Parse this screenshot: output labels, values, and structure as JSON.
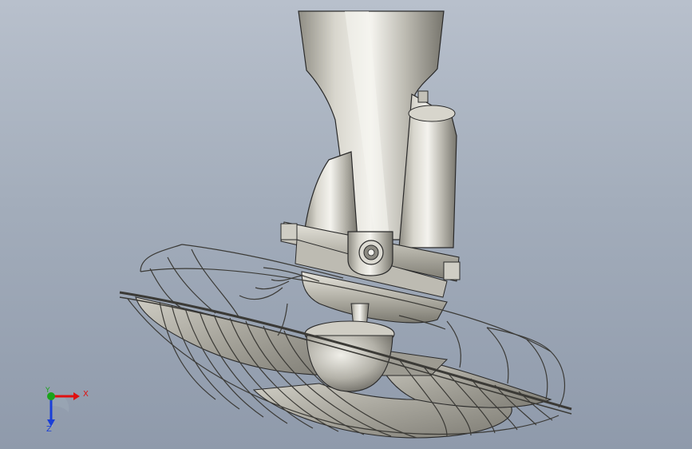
{
  "viewport": {
    "background_top": "#b8c0cc",
    "background_bottom": "#8f9aab"
  },
  "model": {
    "part_type": "ceiling-fan-assembly",
    "material_color": "#c8c6bd",
    "edge_color": "#2a2a2a"
  },
  "triad": {
    "x_label": "X",
    "y_label": "Y",
    "z_label": "Z",
    "x_color": "#e01010",
    "y_color": "#1aa31a",
    "z_color": "#1a3fd8"
  }
}
